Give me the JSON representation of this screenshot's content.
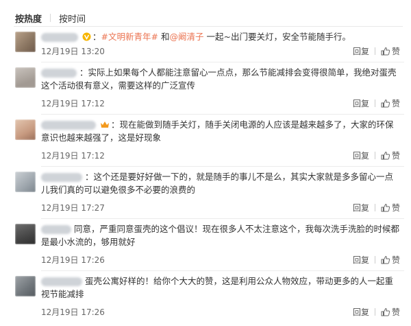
{
  "sort": {
    "hot_label": "按热度",
    "time_label": "按时间"
  },
  "comments": [
    {
      "prefix": "#文明新青年#",
      "mention": "@阚清子",
      "joiner": "和",
      "text": "一起~出门要关灯，安全节能随手行。",
      "time": "12月19日 13:20",
      "reply": "回复",
      "like": "赞"
    },
    {
      "text": "：实际上如果每个人都能注意留心一点点，那么节能减排会变得很简单，我绝对蛋壳这个活动很有意义，需要这样的广泛宣传",
      "time": "12月19日 17:12",
      "reply": "回复",
      "like": "赞"
    },
    {
      "text": "：现在能做到随手关灯，随手关闭电源的人应该是越来越多了，大家的环保意识也越来越强了，这是好现象",
      "time": "12月19日 17:12",
      "reply": "回复",
      "like": "赞"
    },
    {
      "text": "：这个还是要好好做一下的，就是随手的事儿不是么，其实大家就是多多留心一点儿我们真的可以避免很多不必要的浪费的",
      "time": "12月19日 17:27",
      "reply": "回复",
      "like": "赞"
    },
    {
      "text": "同意，严重同意蛋壳的这个倡议！现在很多人不太注意这个，我每次洗手洗脸的时候都是最小水流的，够用就好",
      "time": "12月19日 17:26",
      "reply": "回复",
      "like": "赞"
    },
    {
      "text": "蛋壳公寓好样的！给你个大大的赞，这是利用公众人物效应，带动更多的人一起重视节能减排",
      "time": "12月19日 17:26",
      "reply": "回复",
      "like": "赞"
    }
  ]
}
